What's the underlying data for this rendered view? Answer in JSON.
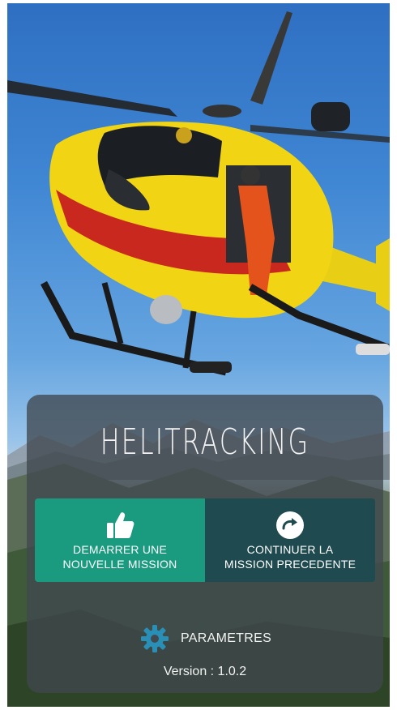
{
  "app": {
    "title": "HELITRACKING"
  },
  "buttons": {
    "new_mission": {
      "label_line1": "DEMARRER UNE",
      "label_line2": "NOUVELLE MISSION",
      "icon": "thumbs-up-icon"
    },
    "continue_mission": {
      "label_line1": "CONTINUER LA",
      "label_line2": "MISSION PRECEDENTE",
      "icon": "redo-arrow-icon"
    }
  },
  "settings": {
    "label": "PARAMETRES",
    "icon": "gear-icon"
  },
  "version": {
    "text": "Version : 1.0.2"
  },
  "colors": {
    "primary_button": "#1a9b7f",
    "secondary_button": "#1f4a4f",
    "settings_icon": "#2a8fb6"
  }
}
